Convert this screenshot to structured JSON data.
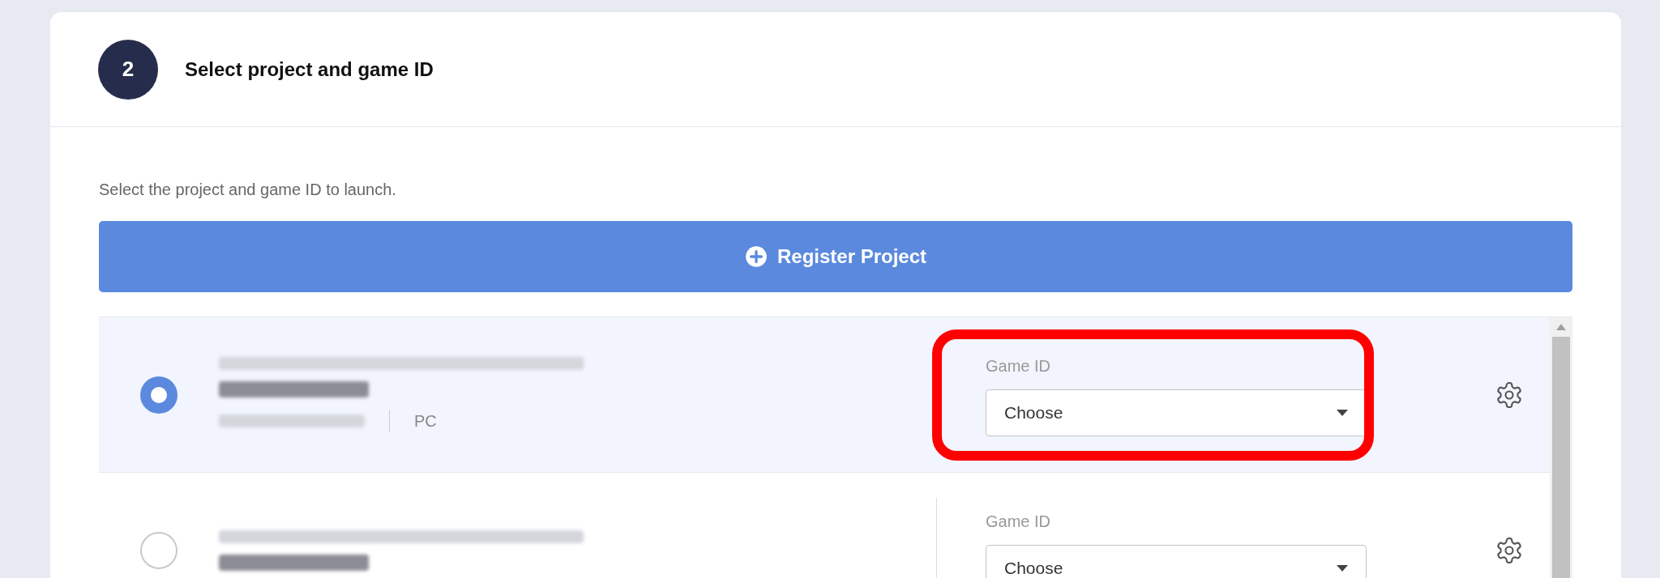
{
  "step": {
    "number": "2",
    "title": "Select project and game ID"
  },
  "description": "Select the project and game ID to launch.",
  "register_button": {
    "label": "Register Project"
  },
  "projects": [
    {
      "selected": true,
      "highlighted": true,
      "platform": "PC",
      "game_id_label": "Game ID",
      "game_id_value": "Choose"
    },
    {
      "selected": false,
      "highlighted": false,
      "game_id_label": "Game ID",
      "game_id_value": "Choose"
    }
  ]
}
